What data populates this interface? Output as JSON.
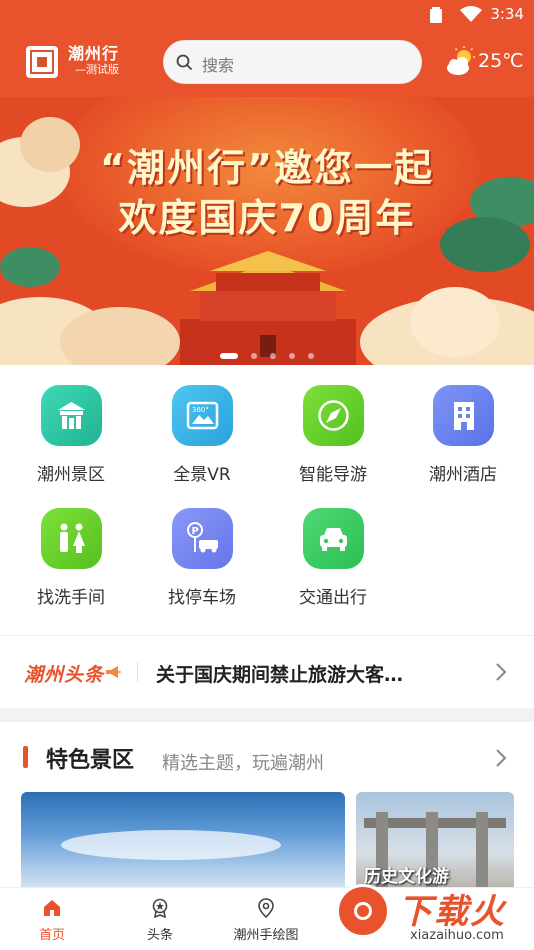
{
  "status_bar": {
    "time": "3:34"
  },
  "app": {
    "brand_name": "潮州行",
    "brand_sub": "—测试版",
    "search_placeholder": "搜索",
    "temperature": "25℃"
  },
  "banner": {
    "headline_line1": "“潮州行”邀您一起",
    "headline_line2": "欢度国庆70周年",
    "page_count": 5,
    "active_page": 0
  },
  "services": [
    {
      "label": "潮州景区",
      "icon": "gate-icon",
      "color": "#2cc7a8"
    },
    {
      "label": "全景VR",
      "icon": "vr-360-icon",
      "color": "#3ab5e6"
    },
    {
      "label": "智能导游",
      "icon": "compass-icon",
      "color": "#6cd12e"
    },
    {
      "label": "潮州酒店",
      "icon": "hotel-building-icon",
      "color": "#6b83f0"
    },
    {
      "label": "找洗手间",
      "icon": "restroom-icon",
      "color": "#69d22a"
    },
    {
      "label": "找停车场",
      "icon": "parking-icon",
      "color": "#7a86f3"
    },
    {
      "label": "交通出行",
      "icon": "car-icon",
      "color": "#39c861"
    }
  ],
  "news": {
    "tag": "潮州头条",
    "headline": "关于国庆期间禁止旅游大客…"
  },
  "featured": {
    "title": "特色景区",
    "subtitle": "精选主题，玩遍潮州",
    "card2_caption": "历史文化游"
  },
  "nav": {
    "items": [
      {
        "label": "首页",
        "icon": "home-icon",
        "active": true
      },
      {
        "label": "头条",
        "icon": "headline-medal-icon",
        "active": false
      },
      {
        "label": "潮州手绘图",
        "icon": "map-pin-icon",
        "active": false
      }
    ]
  },
  "watermark": {
    "big": "下载火",
    "small": "xiazaihuo.com"
  },
  "colors": {
    "brand": "#e8532d",
    "search_bg": "#f5f5f5"
  }
}
